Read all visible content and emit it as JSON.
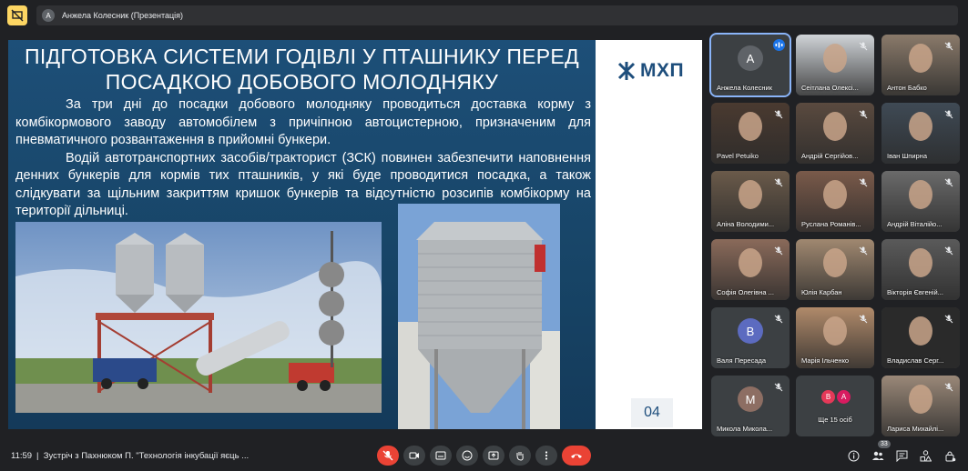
{
  "topbar": {
    "presenter_initial": "А",
    "presenter_label": "Анжела Колесник (Презентація)"
  },
  "slide": {
    "title_line1": "ПІДГОТОВКА СИСТЕМИ ГОДІВЛІ У ПТАШНИКУ ПЕРЕД",
    "title_line2": "ПОСАДКОЮ ДОБОВОГО МОЛОДНЯКУ",
    "paragraph1": "За три дні до посадки добового молодняку проводиться доставка корму з комбікормового заводу автомобілем з причіпною автоцистерною, призначеним для пневматичного розвантаження в прийомні бункери.",
    "paragraph2": "Водій автотранспортних засобів/тракторист (ЗСК) повинен забезпечити наповнення денних бункерів для кормів тих пташників, у які буде проводитися посадка, а також слідкувати за щільним закриттям кришок бункерів та відсутністю розсипів комбікорму на території дільниці.",
    "logo_text": "МХП",
    "page_number": "04",
    "brand_color": "#1e4e7c"
  },
  "participants": [
    {
      "name": "Анжела Колесник",
      "initial": "А",
      "avatar_color": "#5f6368",
      "speaking": true,
      "photo": false
    },
    {
      "name": "Сеітлана Олексі...",
      "initial": "",
      "avatar_color": "#cfd3d7",
      "speaking": false,
      "photo": true
    },
    {
      "name": "Антон Бабко",
      "initial": "",
      "avatar_color": "#8a7a6a",
      "speaking": false,
      "photo": true
    },
    {
      "name": "Pavel Petuiko",
      "initial": "",
      "avatar_color": "#4a3a30",
      "speaking": false,
      "photo": true
    },
    {
      "name": "Андрій Сергійов...",
      "initial": "",
      "avatar_color": "#5a4a3f",
      "speaking": false,
      "photo": true
    },
    {
      "name": "Іван Шпирна",
      "initial": "",
      "avatar_color": "#3f4a55",
      "speaking": false,
      "photo": true
    },
    {
      "name": "Аліна Володими...",
      "initial": "",
      "avatar_color": "#6a5a4a",
      "speaking": false,
      "photo": true
    },
    {
      "name": "Руслана Романів...",
      "initial": "",
      "avatar_color": "#7a5a4a",
      "speaking": false,
      "photo": true
    },
    {
      "name": "Андрій Віталійо...",
      "initial": "",
      "avatar_color": "#6a6a6a",
      "speaking": false,
      "photo": true
    },
    {
      "name": "Софія Олегівна ...",
      "initial": "",
      "avatar_color": "#8a6a5a",
      "speaking": false,
      "photo": true
    },
    {
      "name": "Юлія Карбан",
      "initial": "",
      "avatar_color": "#a08870",
      "speaking": false,
      "photo": true
    },
    {
      "name": "Вікторія Євгеній...",
      "initial": "",
      "avatar_color": "#5a5a5a",
      "speaking": false,
      "photo": true
    },
    {
      "name": "Валя Пересада",
      "initial": "В",
      "avatar_color": "#5c6bc0",
      "speaking": false,
      "photo": false
    },
    {
      "name": "Марія Ільченко",
      "initial": "",
      "avatar_color": "#b08a6a",
      "speaking": false,
      "photo": true
    },
    {
      "name": "Владислав Серг...",
      "initial": "",
      "avatar_color": "#2a2a2a",
      "speaking": false,
      "photo": true
    },
    {
      "name": "Микола Микола...",
      "initial": "М",
      "avatar_color": "#8d6e63",
      "speaking": false,
      "photo": false
    },
    {
      "name": "Ще 15 осіб",
      "initial": "",
      "avatar_color": "",
      "speaking": false,
      "photo": false
    },
    {
      "name": "Лариса Михайлі...",
      "initial": "",
      "avatar_color": "#9a8878",
      "speaking": false,
      "photo": true
    }
  ],
  "more_avatars": [
    {
      "initial": "В",
      "color": "#e53958"
    },
    {
      "initial": "А",
      "color": "#d81b60"
    }
  ],
  "bottombar": {
    "time": "11:59",
    "meeting_title": "Зустріч з Пахнюком П. \"Технологія інкубації яєць ...",
    "participant_count": "33"
  }
}
